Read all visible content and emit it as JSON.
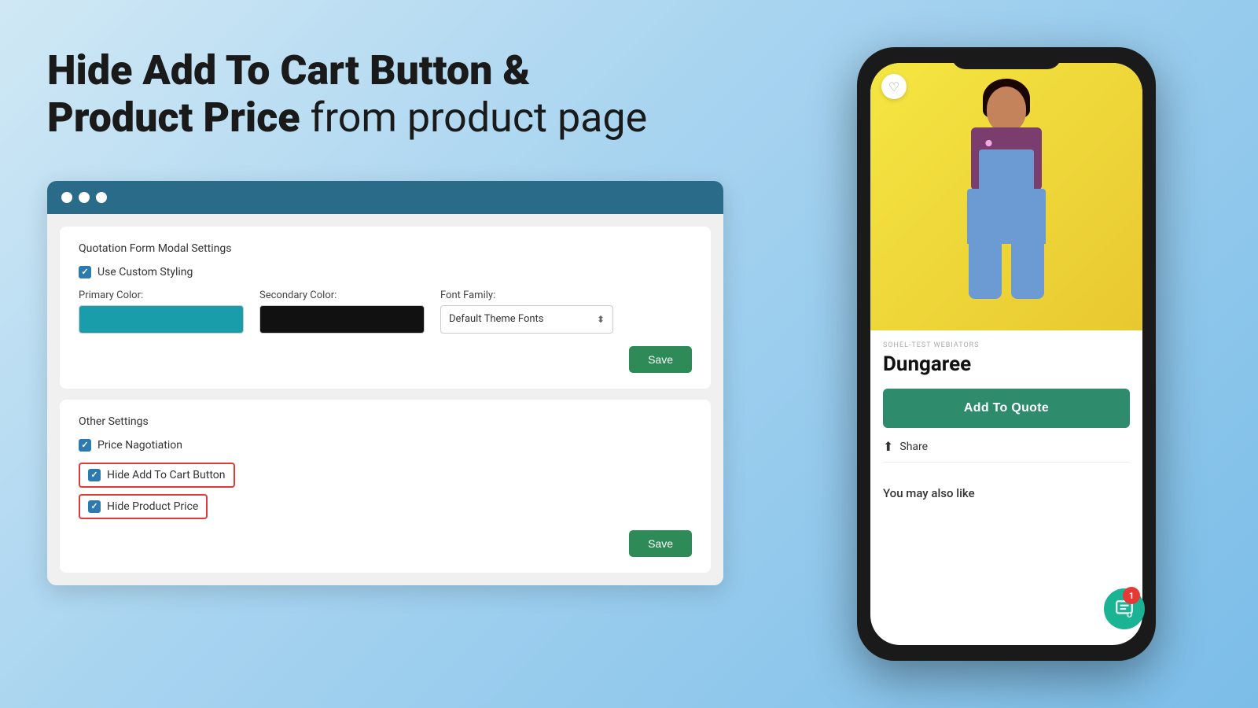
{
  "hero": {
    "title_bold": "Hide Add To Cart Button &\nProduct Price",
    "title_light": " from product page"
  },
  "browser": {
    "dots": [
      "dot1",
      "dot2",
      "dot3"
    ]
  },
  "quotation_panel": {
    "title": "Quotation Form Modal Settings",
    "use_custom_styling_label": "Use Custom Styling",
    "primary_color_label": "Primary Color:",
    "secondary_color_label": "Secondary Color:",
    "font_family_label": "Font Family:",
    "font_family_value": "Default Theme Fonts",
    "save_label": "Save"
  },
  "other_settings_panel": {
    "title": "Other Settings",
    "price_negotiation_label": "Price Nagotiation",
    "hide_add_to_cart_label": "Hide Add To Cart Button",
    "hide_product_price_label": "Hide Product Price",
    "save_label": "Save"
  },
  "phone": {
    "brand": "SOHEL-TEST WEBIATORS",
    "product_name": "Dungaree",
    "add_to_quote_label": "Add To Quote",
    "share_label": "Share",
    "you_may_also_like": "You may also like"
  }
}
